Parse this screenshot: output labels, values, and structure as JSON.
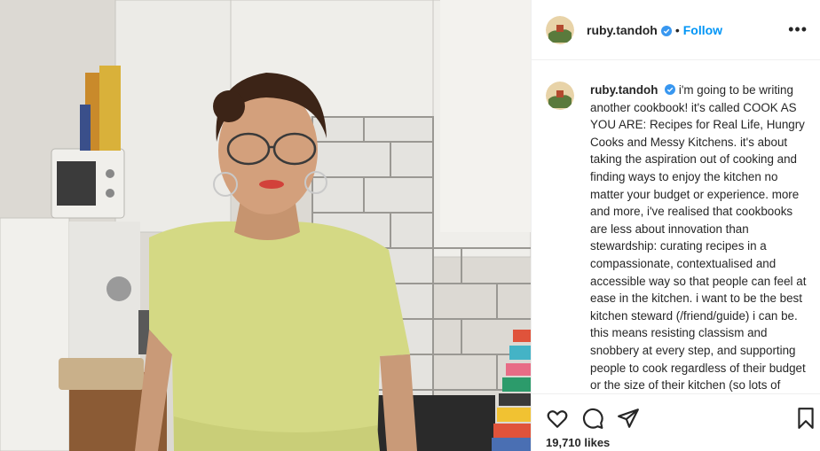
{
  "post": {
    "username": "ruby.tandoh",
    "follow_label": "Follow",
    "separator": "•",
    "more_label": "•••",
    "caption": "i'm going to be writing another cookbook! it's called COOK AS YOU ARE: Recipes for Real Life, Hungry Cooks and Messy Kitchens. it's about taking the aspiration out of cooking and finding ways to enjoy the kitchen no matter your budget or experience. more and more, i've realised that cookbooks are less about innovation than stewardship: curating recipes in a compassionate, contextualised and accessible way so that people can feel at ease in the kitchen. i want to be the best kitchen steward (/friend/guide) i can be. this means resisting classism and snobbery at every step, and supporting people to cook regardless of their budget or the size of their kitchen (so lots of ideas for cheap alternatives, hacks for",
    "likes": "19,710 likes"
  },
  "icons": {
    "verified": "verified-badge-icon",
    "like": "heart-icon",
    "comment": "comment-icon",
    "share": "paper-plane-icon",
    "save": "bookmark-icon"
  },
  "colors": {
    "accent": "#0095f6",
    "text": "#262626",
    "border": "#efefef"
  }
}
